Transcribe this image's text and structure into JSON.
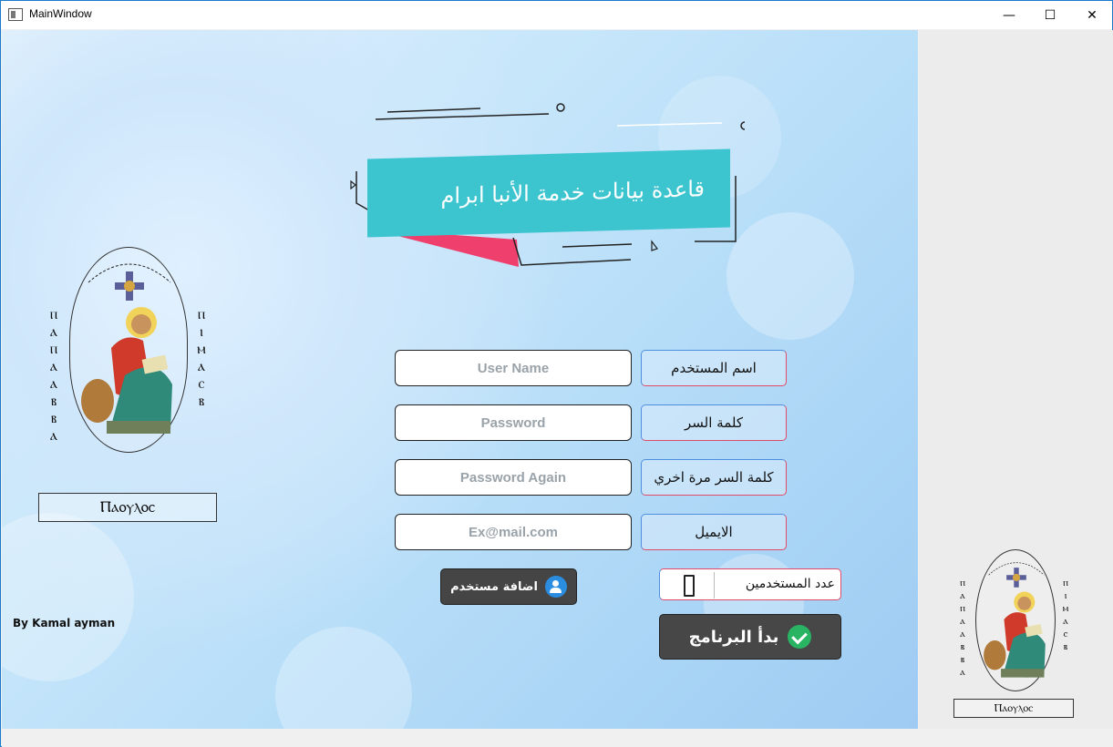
{
  "window": {
    "title": "MainWindow",
    "minimize": "—",
    "maximize": "☐",
    "close": "✕"
  },
  "banner": {
    "title": "قاعدة بيانات خدمة الأنبا ابرام"
  },
  "logo": {
    "caption": "Ⲡⲁⲟⲩⲗⲟⲥ",
    "left_letters": "ⲡ ⲁ ⲡ ⲁ   ⲁ ⲃ ⲃ ⲁ",
    "right_letters": "ⲡ ⲓ ⲙ ⲁ ⲥ ⲃ"
  },
  "form": {
    "username": {
      "label": "اسم المستخدم",
      "placeholder": "User Name",
      "value": ""
    },
    "password": {
      "label": "كلمة السر",
      "placeholder": "Password",
      "value": ""
    },
    "password_again": {
      "label": "كلمة السر مرة اخري",
      "placeholder": "Password Again",
      "value": ""
    },
    "email": {
      "label": "الايميل",
      "placeholder": "Ex@mail.com",
      "value": ""
    }
  },
  "add_user_button": {
    "label": "اضافة مستخدم",
    "icon": "add-user-icon"
  },
  "user_count": {
    "label": "عدد المستخدمين",
    "value": "0"
  },
  "start_button": {
    "label": "بدأ البرنامج",
    "icon": "check-icon"
  },
  "credit": "By Kamal ayman",
  "colors": {
    "accent_teal": "#3cc4cf",
    "accent_pink": "#ef3f6c",
    "button_dark": "#454545",
    "check_green": "#28b463",
    "user_icon_blue": "#2b8de0"
  }
}
